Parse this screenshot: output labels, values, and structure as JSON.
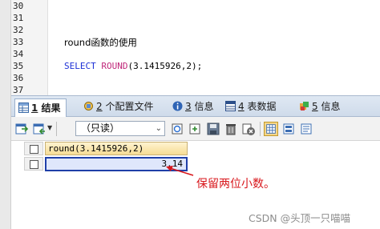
{
  "editor": {
    "lines": [
      {
        "num": "30",
        "code": ""
      },
      {
        "num": "31",
        "code": ""
      },
      {
        "num": "32",
        "code": ""
      },
      {
        "num": "33",
        "code": "round函数的使用"
      },
      {
        "num": "34",
        "code": ""
      },
      {
        "num": "35",
        "code_keyword": "SELECT",
        "code_fn": "ROUND",
        "code_args": "(3.1415926,2);"
      },
      {
        "num": "36",
        "code": ""
      },
      {
        "num": "37",
        "code": ""
      }
    ]
  },
  "tabs": [
    {
      "num": "1",
      "label": "结果",
      "icon": "results-grid-icon",
      "active": true
    },
    {
      "num": "2",
      "label": "个配置文件",
      "icon": "profile-icon",
      "active": false
    },
    {
      "num": "3",
      "label": "信息",
      "icon": "info-icon",
      "active": false
    },
    {
      "num": "4",
      "label": "表数据",
      "icon": "table-data-icon",
      "active": false
    },
    {
      "num": "5",
      "label": "信息",
      "icon": "messages-icon",
      "active": false
    }
  ],
  "toolbar": {
    "mode_select": "（只读）",
    "buttons": [
      "export-icon",
      "import-icon",
      "refresh-icon",
      "add-row-icon",
      "save-icon",
      "delete-icon",
      "cancel-icon",
      "grid-view-icon",
      "form-view-icon",
      "text-view-icon"
    ]
  },
  "grid": {
    "column_header": "round(3.1415926,2)",
    "value": "3.14"
  },
  "annotation": "保留两位小数。",
  "watermark": "CSDN @头顶一只喵喵",
  "colors": {
    "annotation_red": "#d8161b",
    "keyword_blue": "#1c2fd6",
    "function_magenta": "#c0287a",
    "selection_border": "#1f3fa8"
  }
}
